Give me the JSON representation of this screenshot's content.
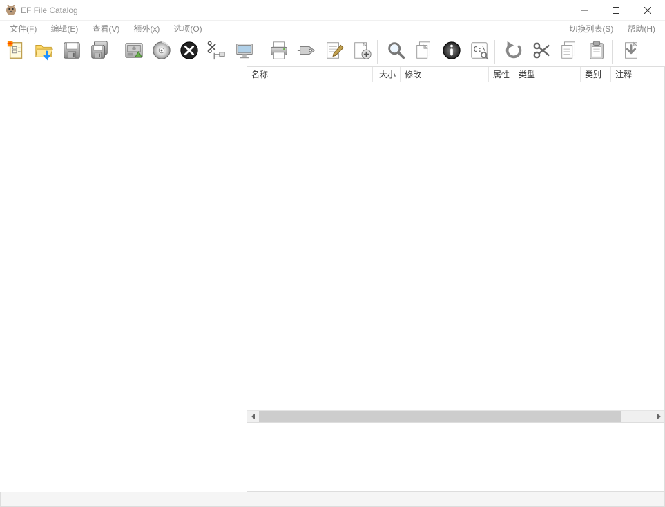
{
  "window": {
    "title": "EF File Catalog"
  },
  "menu": {
    "file": "文件(F)",
    "edit": "编辑(E)",
    "view": "查看(V)",
    "extra": "额外(x)",
    "options": "选项(O)",
    "switch_list": "切换列表(S)",
    "help": "帮助(H)"
  },
  "toolbar_icons": {
    "new_catalog": "new-catalog-icon",
    "open_folder": "open-folder-icon",
    "save": "save-icon",
    "save_all": "save-all-icon",
    "drive": "drive-icon",
    "disc": "disc-icon",
    "close": "close-catalog-icon",
    "cut": "cut-icon",
    "monitor": "monitor-icon",
    "print": "print-icon",
    "tag": "tag-icon",
    "edit": "edit-icon",
    "add_file": "add-file-icon",
    "search": "search-icon",
    "duplicate": "duplicate-icon",
    "info": "info-icon",
    "explorer": "explorer-icon",
    "undo": "undo-icon",
    "scissors": "scissors-icon",
    "copy": "copy-icon",
    "paste": "paste-icon",
    "export": "export-icon"
  },
  "columns": {
    "name": "名称",
    "size": "大小",
    "modified": "修改",
    "attributes": "属性",
    "type": "类型",
    "category": "类别",
    "notes": "注释"
  },
  "explorer_label": "C:\\"
}
